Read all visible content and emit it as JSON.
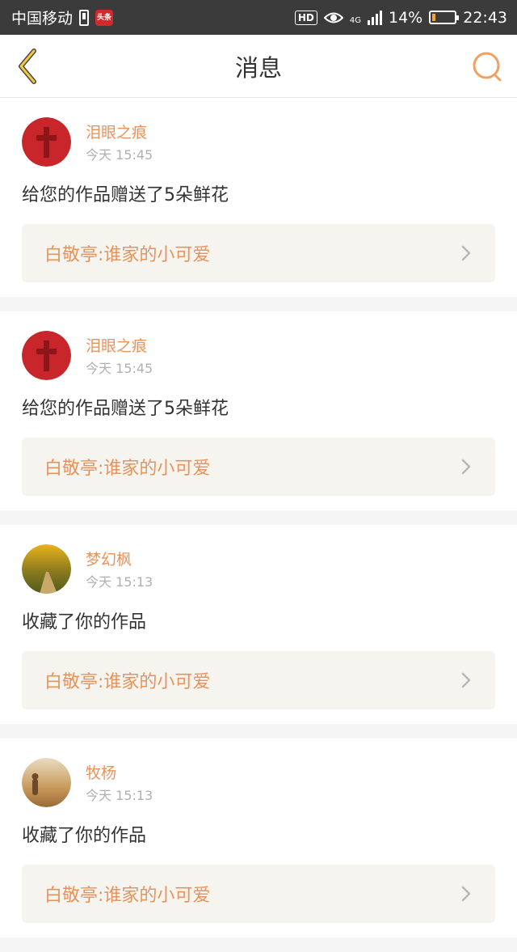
{
  "status_bar": {
    "carrier": "中国移动",
    "app_badge": "头条",
    "hd": "HD",
    "network": "4G",
    "battery_percent_text": "14%",
    "battery_level": 0.14,
    "time": "22:43"
  },
  "header": {
    "title": "消息"
  },
  "colors": {
    "accent": "#e8935c",
    "card_link_bg": "#f5f4ee",
    "status_bar_bg": "#3b3b3b"
  },
  "messages": [
    {
      "user": "泪眼之痕",
      "time": "今天 15:45",
      "action": "给您的作品赠送了5朵鲜花",
      "work": "白敬亭:谁家的小可爱",
      "avatar": "red-cross-avatar"
    },
    {
      "user": "泪眼之痕",
      "time": "今天 15:45",
      "action": "给您的作品赠送了5朵鲜花",
      "work": "白敬亭:谁家的小可爱",
      "avatar": "red-cross-avatar"
    },
    {
      "user": "梦幻枫",
      "time": "今天 15:13",
      "action": "收藏了你的作品",
      "work": "白敬亭:谁家的小可爱",
      "avatar": "autumn-road-avatar"
    },
    {
      "user": "牧杨",
      "time": "今天 15:13",
      "action": "收藏了你的作品",
      "work": "白敬亭:谁家的小可爱",
      "avatar": "desert-figure-avatar"
    }
  ]
}
